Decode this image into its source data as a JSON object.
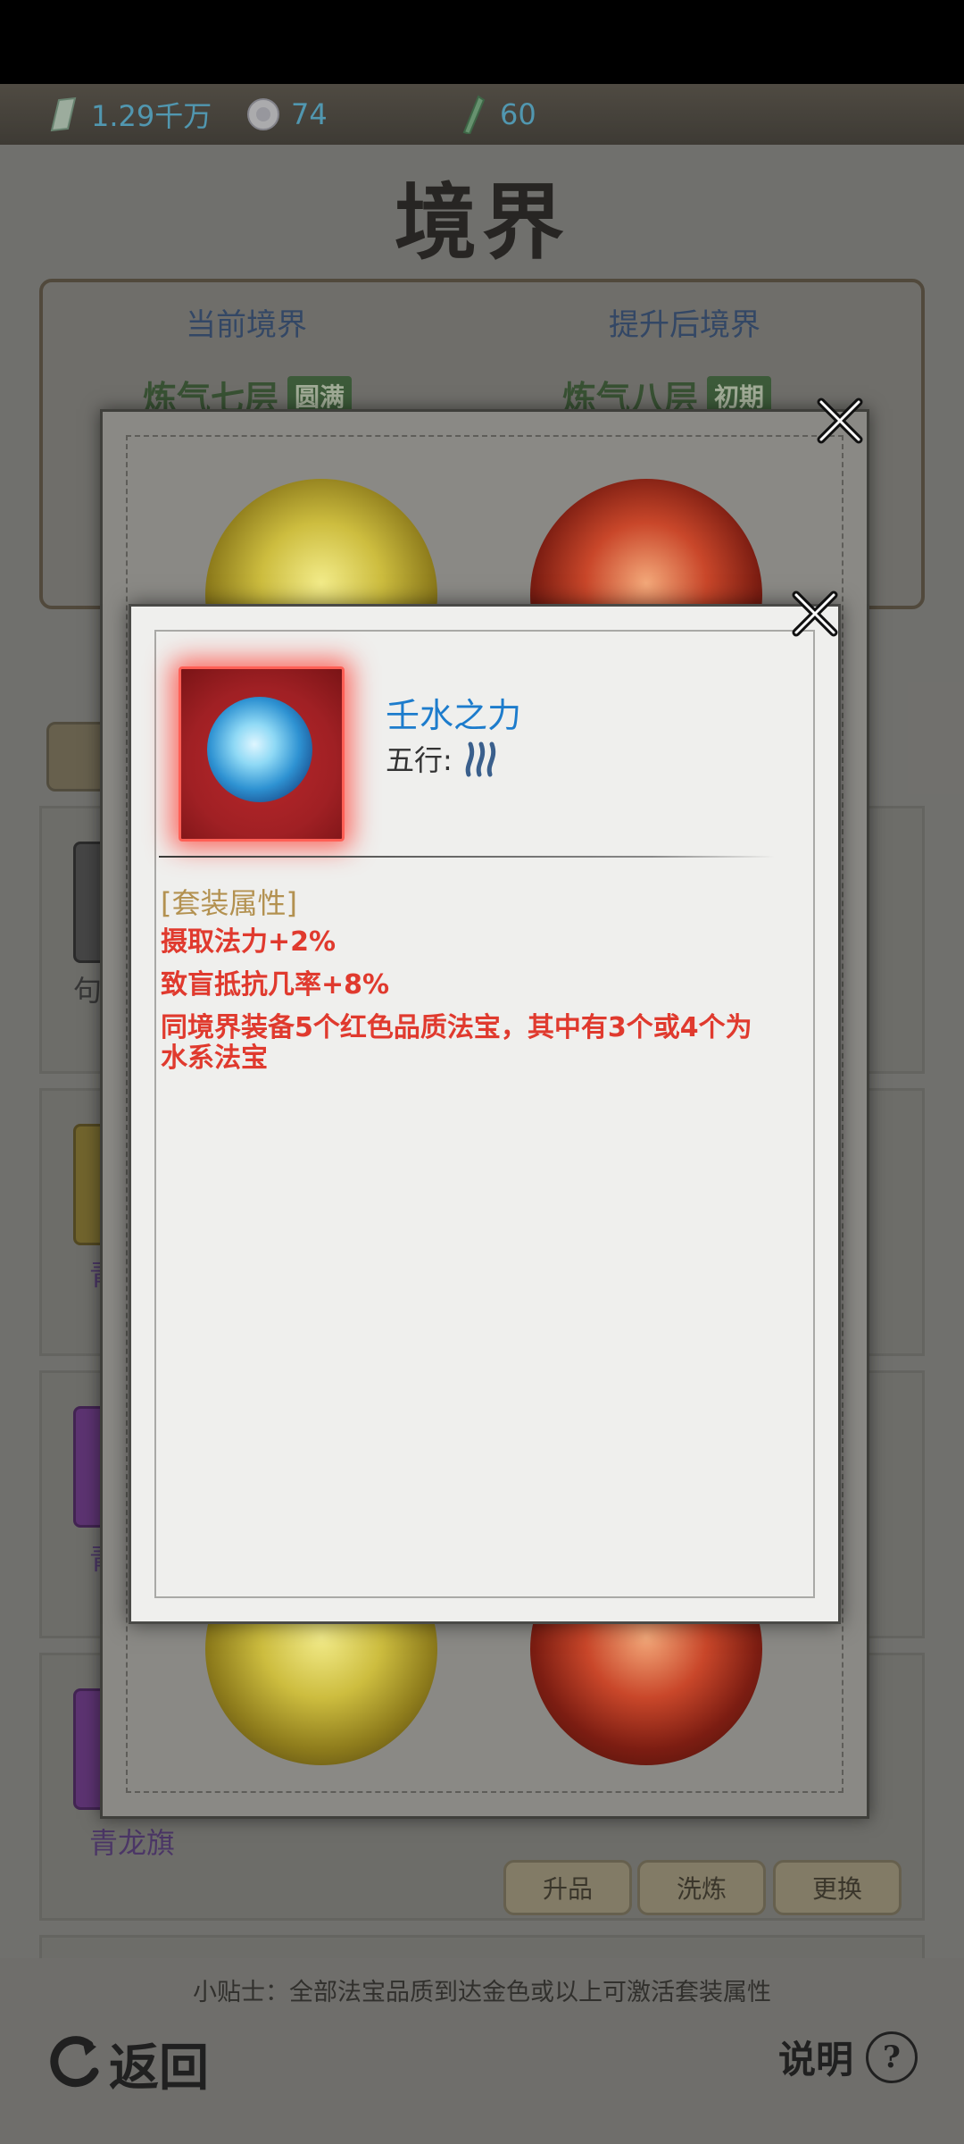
{
  "currency": [
    {
      "icon": "jade-icon",
      "value": "1.29千万"
    },
    {
      "icon": "pearl-icon",
      "value": "74"
    },
    {
      "icon": "bamboo-scroll-icon",
      "value": "60"
    }
  ],
  "page": {
    "title": "境界",
    "current_realm_label": "当前境界",
    "next_realm_label": "提升后境界",
    "current_realm": "炼气七层",
    "current_realm_tag": "圆满",
    "next_realm": "炼气八层",
    "next_realm_tag": "初期",
    "items": [
      {
        "name": "句"
      },
      {
        "name": "青"
      },
      {
        "name": "青"
      },
      {
        "name": "青龙旗"
      }
    ],
    "buttons": {
      "upgrade": "升品",
      "refine": "洗炼",
      "replace": "更换"
    },
    "tip": "小贴士：全部法宝品质到达金色或以上可激活套装属性",
    "back_label": "返回",
    "help_label": "说明",
    "help_icon_text": "?"
  },
  "popup": {
    "item_name": "壬水之力",
    "wuxing_label": "五行:",
    "wuxing_icon": "water-element-icon",
    "set_header": "[套装属性]",
    "attributes": [
      "摄取法力+2%",
      "致盲抵抗几率+8%",
      "同境界装备5个红色品质法宝，其中有3个或4个为水系法宝"
    ]
  },
  "colors": {
    "accent_blue": "#1d7ccc",
    "attr_red": "#e03a2e",
    "header_gold": "#b39150",
    "currency_cyan": "#5cc8ee"
  }
}
